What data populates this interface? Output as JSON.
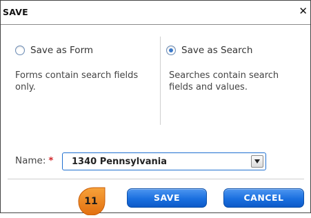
{
  "dialog": {
    "title": "SAVE",
    "close_icon": "close-x-icon"
  },
  "options": {
    "form": {
      "label": "Save as Form",
      "description": "Forms contain search fields only.",
      "selected": false
    },
    "search": {
      "label": "Save as Search",
      "description": "Searches contain search fields and values.",
      "selected": true
    }
  },
  "name_field": {
    "label": "Name:",
    "required_marker": "*",
    "value": "1340 Pennsylvania"
  },
  "badge": {
    "text": "11",
    "color": "#f08a1c"
  },
  "buttons": {
    "save_label": "SAVE",
    "cancel_label": "CANCEL"
  },
  "colors": {
    "accent": "#1a6fdf",
    "required": "#d2262a",
    "radio_selected": "#3b79c9"
  }
}
